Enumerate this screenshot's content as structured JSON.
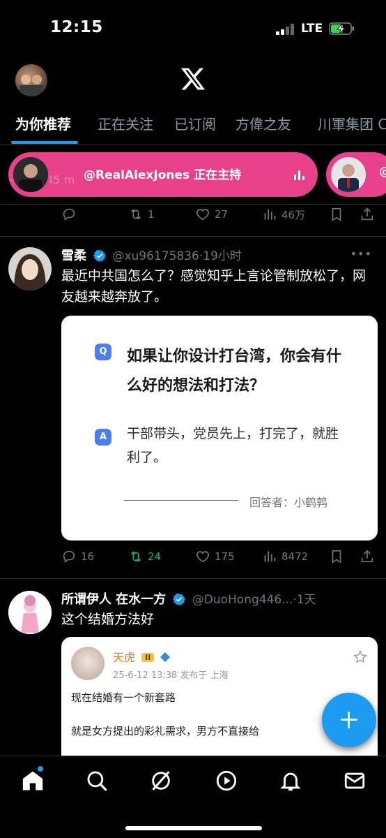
{
  "status_bar": {
    "time": "12:15",
    "network": "LTE"
  },
  "tabs": [
    "为你推荐",
    "正在关注",
    "已订阅",
    "方偉之友",
    "川軍集团 C"
  ],
  "spaces": {
    "faded_text": "+639545 m",
    "host_text": "@RealAlexJones 正在主持",
    "second_text": "@"
  },
  "tweet0_actions": {
    "replies": "",
    "retweets": "1",
    "likes": "27",
    "views": "46万"
  },
  "tweet1": {
    "name": "雪柔",
    "handle": "@xu96175836",
    "time": "·19小时",
    "text": "最近中共国怎么了？感觉知乎上言论管制放松了，网友越来越奔放了。",
    "card": {
      "q_badge": "Q",
      "question": "如果让你设计打台湾，你会有什么好的想法和打法？",
      "a_badge": "A",
      "answer": "干部带头，党员先上，打完了，就胜利了。",
      "answerer": "回答者：小鹤鹑"
    },
    "actions": {
      "replies": "16",
      "retweets": "24",
      "likes": "175",
      "views": "8472"
    }
  },
  "tweet2": {
    "name": "所谓伊人 在水一方",
    "handle": "@DuoHong446...",
    "time": "·1天",
    "text": "这个结婚方法好",
    "card": {
      "user": "天虎",
      "level": "II",
      "meta": "25-6-12 13:38  发布于 上海",
      "line1": "现在结婚有一个新套路",
      "line2": "就是女方提出的彩礼需求，男方不直接给"
    }
  },
  "colors": {
    "accent": "#1d9bf0",
    "space_pink": "#e8408b",
    "retweet_green": "#00ba7c"
  }
}
